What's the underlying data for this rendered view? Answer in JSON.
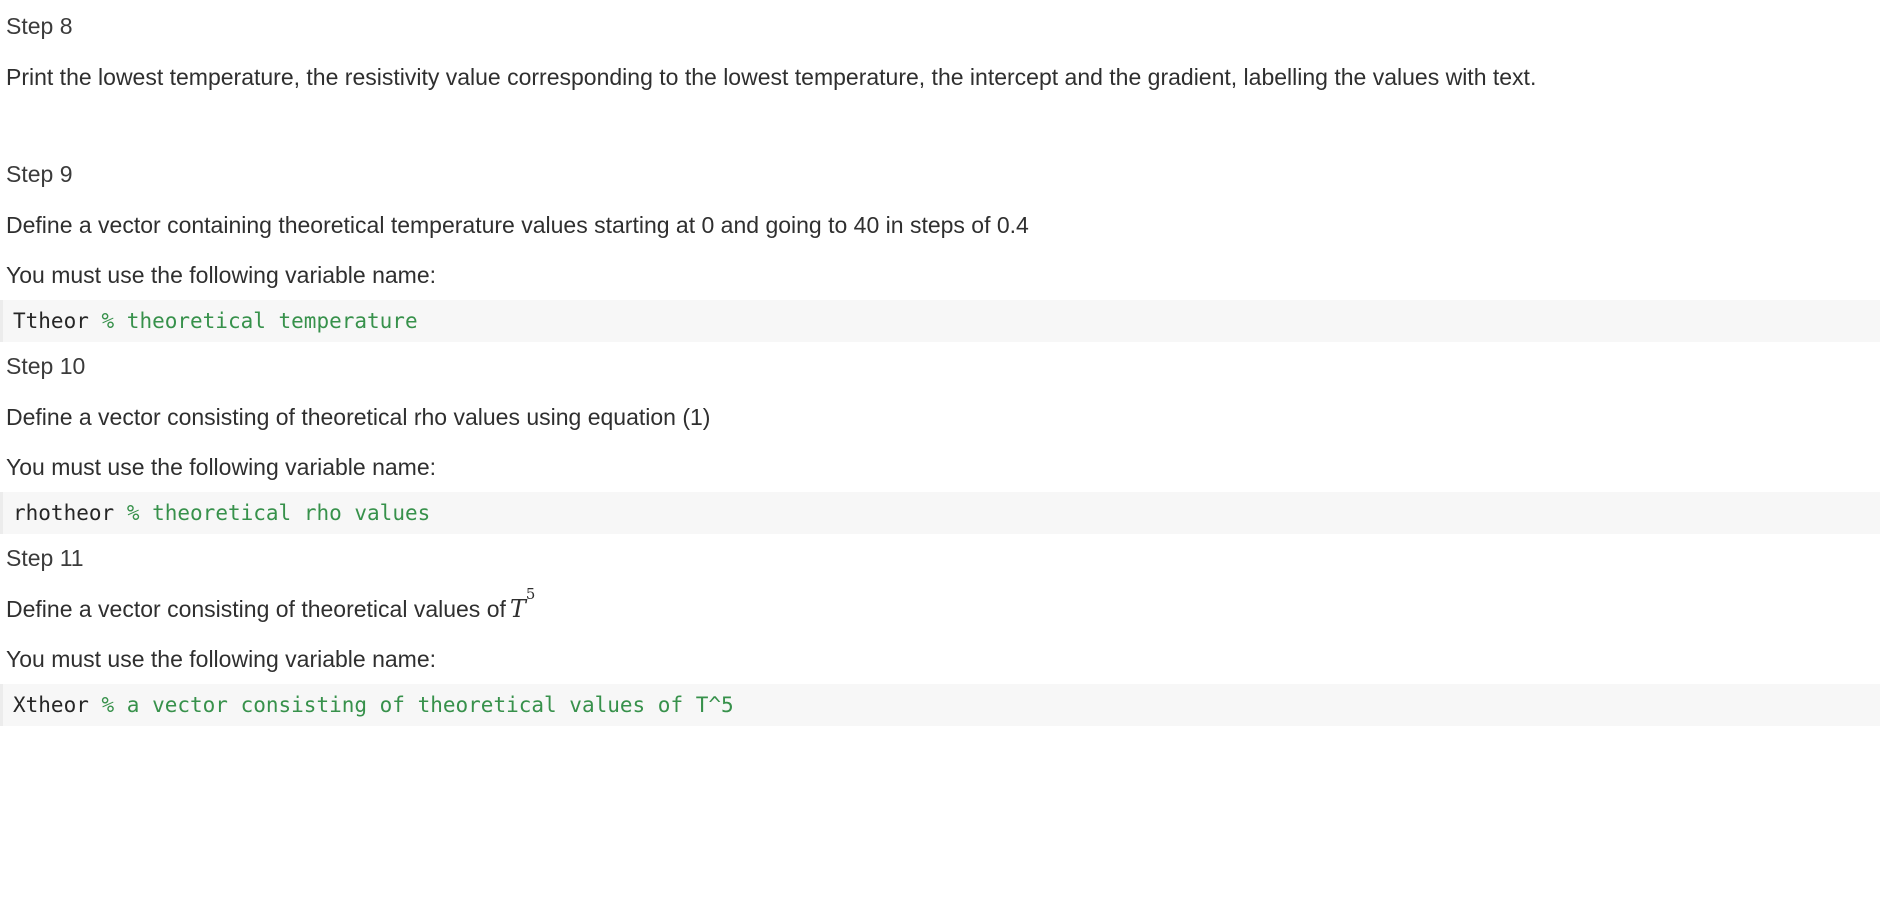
{
  "document": {
    "colors": {
      "text": "#2f2f2f",
      "code_text": "#262626",
      "code_comment": "#37914b",
      "code_background": "#f7f7f7",
      "code_border": "#ececec",
      "page_background": "#ffffff"
    },
    "blocks": [
      {
        "id": "step8",
        "heading": "Step 8",
        "paragraph": "Print the lowest temperature, the resistivity value corresponding to the lowest temperature, the intercept and the gradient, labelling the values with text."
      },
      {
        "id": "step9",
        "heading": "Step 9",
        "paragraph": "Define a vector containing theoretical temperature values starting at 0 and going to 40 in steps of 0.4",
        "instruction": "You must use the following variable name:",
        "code_variable": "Ttheor",
        "code_comment": "% theoretical temperature"
      },
      {
        "id": "step10",
        "heading": "Step 10",
        "paragraph": "Define a vector consisting of theoretical rho values using equation (1)",
        "instruction": "You must use the following variable name:",
        "code_variable": "rhotheor",
        "code_comment": "% theoretical rho values"
      },
      {
        "id": "step11",
        "heading": "Step 11",
        "paragraph_prefix": "Define a vector consisting of theoretical values of",
        "math_base": "T",
        "math_exponent": "5",
        "instruction": "You must use the following variable name:",
        "code_variable": "Xtheor",
        "code_comment": "% a vector consisting of theoretical values of T^5"
      }
    ]
  }
}
